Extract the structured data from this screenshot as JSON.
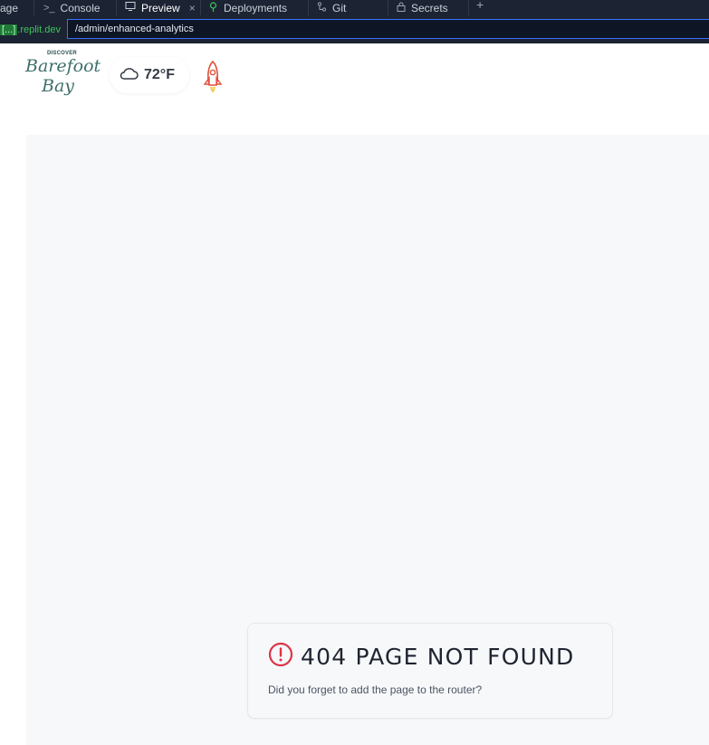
{
  "tabs": [
    {
      "label": "age",
      "icon": ""
    },
    {
      "label": "Console",
      "icon": ">_"
    },
    {
      "label": "Preview",
      "icon": "monitor-icon",
      "active": true,
      "close": "×"
    },
    {
      "label": "Deployments",
      "icon": "deploy-icon"
    },
    {
      "label": "Git",
      "icon": "git-branch-icon"
    },
    {
      "label": "Secrets",
      "icon": "lock-icon"
    }
  ],
  "tab_add": "+",
  "urlbar": {
    "domain_highlight": "[...]",
    "domain_suffix": ".replit.dev",
    "path": "/admin/enhanced-analytics"
  },
  "header": {
    "logo_top": "DISCOVER",
    "logo_line1": "Barefoot",
    "logo_line2": "Bay",
    "weather_icon": "cloud-icon",
    "temperature": "72°F",
    "rocket_icon": "rocket-icon"
  },
  "error_card": {
    "icon": "alert-circle-icon",
    "title": "404 PAGE NOT FOUND",
    "message": "Did you forget to add the page to the router?"
  },
  "colors": {
    "ide_bg": "#1c2333",
    "accent_blue": "#3a6fff",
    "domain_green": "#3ec45a",
    "error_red": "#dc3545",
    "content_bg": "#f7f8fa"
  }
}
